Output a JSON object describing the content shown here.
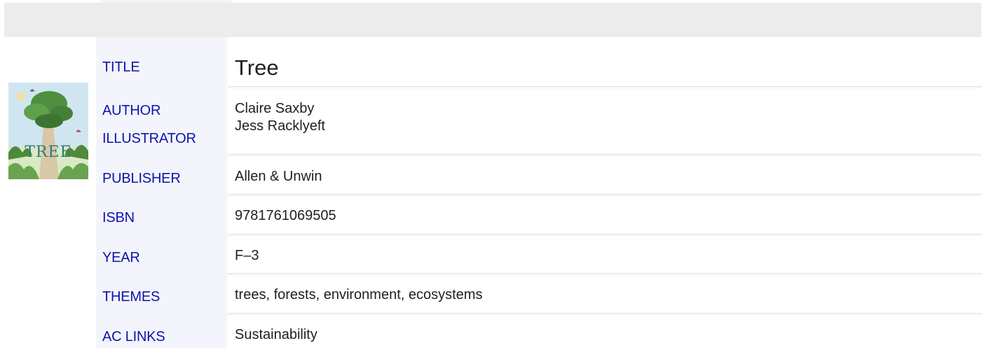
{
  "book": {
    "cover": {
      "title_text": "TREE",
      "colors": {
        "sky": "#cfe6f1",
        "trunk": "#d8c8a8",
        "foliage": "#4f8f3e",
        "title": "#2f7a76"
      }
    },
    "fields": [
      {
        "key": "title",
        "label": "TITLE",
        "values": [
          "Tree"
        ]
      },
      {
        "key": "author-illustrator",
        "label": "AUTHOR",
        "label2": "ILLUSTRATOR",
        "values": [
          "Claire Saxby",
          "Jess Racklyeft"
        ]
      },
      {
        "key": "publisher",
        "label": "PUBLISHER",
        "values": [
          "Allen & Unwin"
        ]
      },
      {
        "key": "isbn",
        "label": "ISBN",
        "values": [
          "9781761069505"
        ]
      },
      {
        "key": "year",
        "label": "YEAR",
        "values": [
          "F–3"
        ]
      },
      {
        "key": "themes",
        "label": "THEMES",
        "values": [
          "trees, forests, environment, ecosystems"
        ]
      },
      {
        "key": "ac-links",
        "label": "AC LINKS",
        "values": [
          "Sustainability"
        ]
      }
    ]
  },
  "colors": {
    "label_text": "#0a16a8",
    "label_column_bg": "#f4f4fc",
    "header_band_bg": "#ececec",
    "value_text": "#1f1f1f"
  }
}
